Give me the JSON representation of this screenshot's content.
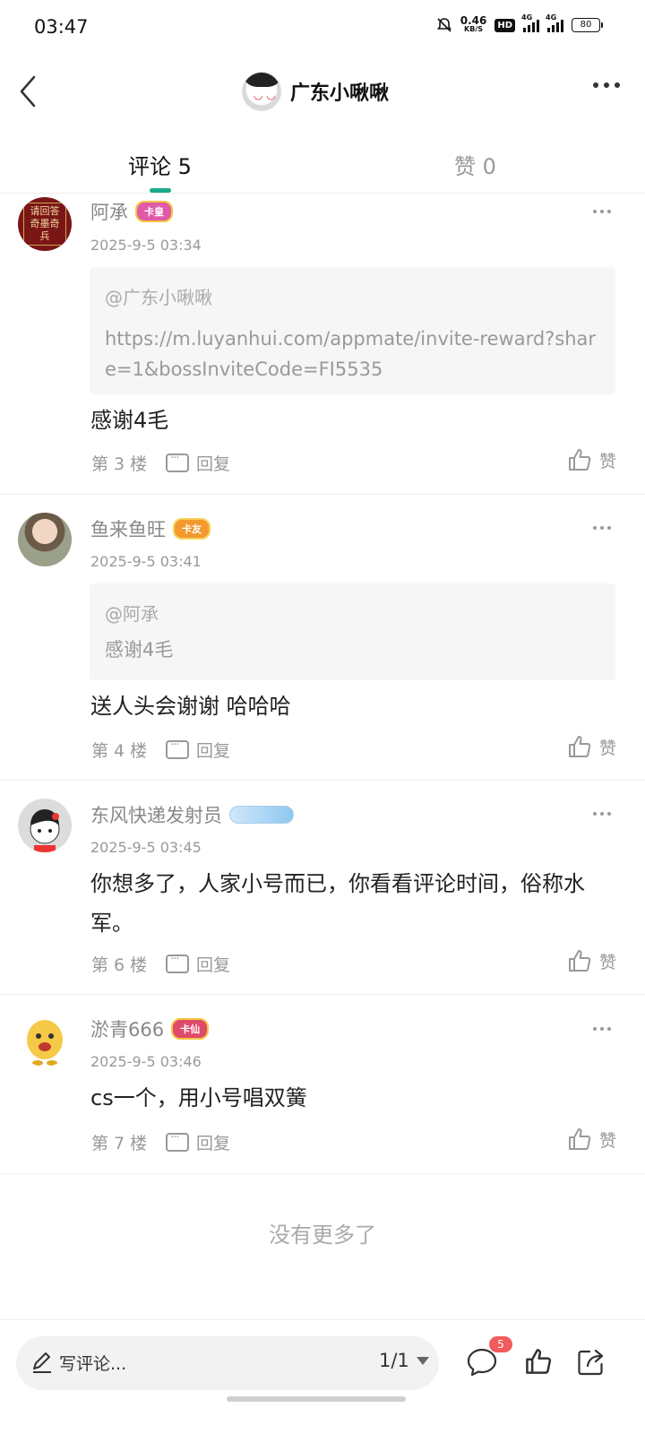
{
  "status": {
    "time": "03:47",
    "net_speed": "0.46",
    "net_unit": "KB/S",
    "hd": "HD",
    "sig1_label": "4G",
    "sig2_label": "4G",
    "battery": "80"
  },
  "nav": {
    "title": "广东小啾啾"
  },
  "tabs": {
    "comments": "评论 5",
    "likes": "赞 0"
  },
  "comments": [
    {
      "username": "阿承",
      "badge": "卡皇",
      "badge_color": "#e05aa8",
      "avatar_text": "请回答 奇墨奇兵",
      "timestamp": "2025-9-5 03:34",
      "quote_author": "@广东小啾啾",
      "quote_text": "https://m.luyanhui.com/appmate/invite-reward?share=1&bossInviteCode=FI5535",
      "body": "感谢4毛",
      "floor": "第 3 楼",
      "reply": "回复",
      "like": "赞"
    },
    {
      "username": "鱼来鱼旺",
      "badge": "卡友",
      "badge_color": "#f29a2e",
      "timestamp": "2025-9-5 03:41",
      "quote_author": "@阿承",
      "quote_text": "感谢4毛",
      "body": "送人头会谢谢 哈哈哈",
      "floor": "第 4 楼",
      "reply": "回复",
      "like": "赞"
    },
    {
      "username": "东风快递发射员",
      "badge_color": "#8fc7f0",
      "timestamp": "2025-9-5 03:45",
      "body": "你想多了，人家小号而已，你看看评论时间，俗称水军。",
      "floor": "第 6 楼",
      "reply": "回复",
      "like": "赞"
    },
    {
      "username": "淤青666",
      "badge": "卡仙",
      "badge_color": "#e04a6a",
      "timestamp": "2025-9-5 03:46",
      "body": "cs一个，用小号唱双簧",
      "floor": "第 7 楼",
      "reply": "回复",
      "like": "赞"
    }
  ],
  "no_more": "没有更多了",
  "bottom": {
    "placeholder": "写评论...",
    "page": "1/1",
    "comment_count": "5"
  },
  "colors": {
    "accent": "#1aaa8b",
    "badge_red": "#f25b5b"
  }
}
